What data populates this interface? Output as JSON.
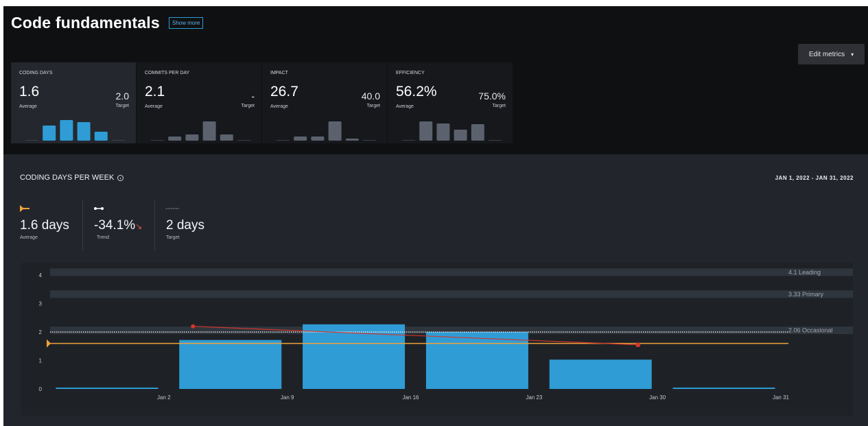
{
  "header": {
    "title": "Code fundamentals",
    "show_more_label": "Show more",
    "edit_metrics_label": "Edit metrics",
    "caret_glyph": "▾"
  },
  "metric_cards": [
    {
      "title": "CODING DAYS",
      "average": "1.6",
      "average_label": "Average",
      "target": "2.0",
      "target_label": "Target",
      "bars": [
        0,
        2.2,
        3.0,
        2.7,
        1.3,
        0
      ],
      "bar_max": 3.0,
      "bar_color": "#2f9cd6"
    },
    {
      "title": "COMMITS PER DAY",
      "average": "2.1",
      "average_label": "Average",
      "target": "-",
      "target_label": "Target",
      "bars": [
        0,
        0.6,
        0.9,
        2.8,
        0.9,
        0
      ],
      "bar_max": 3.0,
      "bar_color": "#5b626d"
    },
    {
      "title": "IMPACT",
      "average": "26.7",
      "average_label": "Average",
      "target": "40.0",
      "target_label": "Target",
      "bars": [
        0,
        0.6,
        0.6,
        2.8,
        0.3,
        0
      ],
      "bar_max": 3.0,
      "bar_color": "#5b626d"
    },
    {
      "title": "EFFICIENCY",
      "average": "56.2%",
      "average_label": "Average",
      "target": "75.0%",
      "target_label": "Target",
      "bars": [
        0,
        2.8,
        2.5,
        1.6,
        2.4,
        0
      ],
      "bar_max": 3.0,
      "bar_color": "#5b626d"
    }
  ],
  "chart_panel": {
    "title": "CODING DAYS PER WEEK",
    "date_range": "JAN 1, 2022 - JAN 31, 2022",
    "summary": {
      "average": {
        "value": "1.6 days",
        "label": "Average",
        "icon": "average-marker-icon",
        "color": "#f0a23a"
      },
      "trend": {
        "value": "-34.1%",
        "arrow": "↘",
        "label": "Trend",
        "icon": "trend-line-icon"
      },
      "target": {
        "value": "2 days",
        "label": "Target",
        "icon": "dotted-target-icon"
      }
    }
  },
  "chart_data": {
    "type": "bar",
    "categories": [
      "Jan 2",
      "Jan 9",
      "Jan 16",
      "Jan 23",
      "Jan 30",
      "Jan 31"
    ],
    "values": [
      0,
      1.72,
      2.27,
      2.0,
      1.03,
      0
    ],
    "ylim": [
      0,
      4.2
    ],
    "yticks": [
      0,
      1,
      2,
      3,
      4
    ],
    "average": 1.6,
    "target": 2,
    "trend": {
      "start": 2.2,
      "end": 1.55
    },
    "benchmarks": [
      {
        "value": 4.1,
        "label": "4.1 Leading"
      },
      {
        "value": 3.33,
        "label": "3.33 Primary"
      },
      {
        "value": 2.06,
        "label": "2.06 Occasional"
      }
    ],
    "colors": {
      "bar": "#2f9cd6",
      "average": "#f0a23a",
      "trend": "#d2372b",
      "target": "#ffffff",
      "benchmark": "#2f353d"
    }
  }
}
